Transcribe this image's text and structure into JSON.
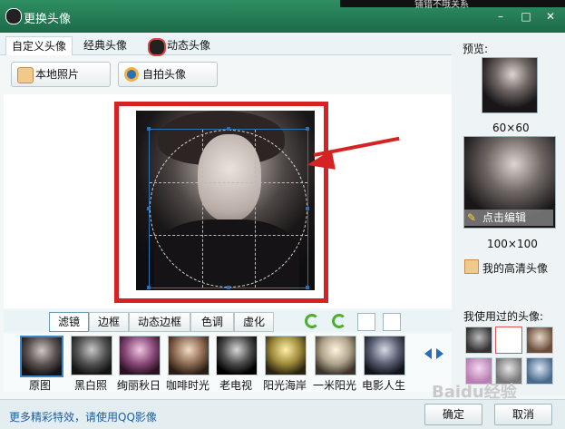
{
  "window": {
    "title": "更换头像",
    "background_snippet": "铺错不哦关系"
  },
  "tabs": [
    {
      "label": "自定义头像",
      "active": true
    },
    {
      "label": "经典头像",
      "active": false
    },
    {
      "label": "动态头像",
      "active": false
    }
  ],
  "toolbar": {
    "local_photo_label": "本地照片",
    "selfie_label": "自拍头像"
  },
  "effects": {
    "tabs": [
      {
        "label": "滤镜",
        "active": true
      },
      {
        "label": "边框",
        "active": false
      },
      {
        "label": "动态边框",
        "active": false
      },
      {
        "label": "色调",
        "active": false
      },
      {
        "label": "虚化",
        "active": false
      }
    ],
    "filters": [
      {
        "label": "原图",
        "selected": true
      },
      {
        "label": "黑白照",
        "selected": false
      },
      {
        "label": "绚丽秋日",
        "selected": false
      },
      {
        "label": "咖啡时光",
        "selected": false
      },
      {
        "label": "老电视",
        "selected": false
      },
      {
        "label": "阳光海岸",
        "selected": false
      },
      {
        "label": "一米阳光",
        "selected": false
      },
      {
        "label": "电影人生",
        "selected": false
      }
    ]
  },
  "preview": {
    "heading": "预览:",
    "small_size": "60×60",
    "large_size": "100×100",
    "edit_label": "点击编辑",
    "hd_avatar_label": "我的高清头像"
  },
  "history": {
    "heading": "我使用过的头像:"
  },
  "footer": {
    "hint": "更多精彩特效，请使用QQ影像",
    "confirm_label": "确定",
    "cancel_label": "取消"
  },
  "watermark": "Baidu经验",
  "colors": {
    "accent_red": "#d52222",
    "title_green": "#2f8f63",
    "link_blue": "#1a5fa8"
  }
}
